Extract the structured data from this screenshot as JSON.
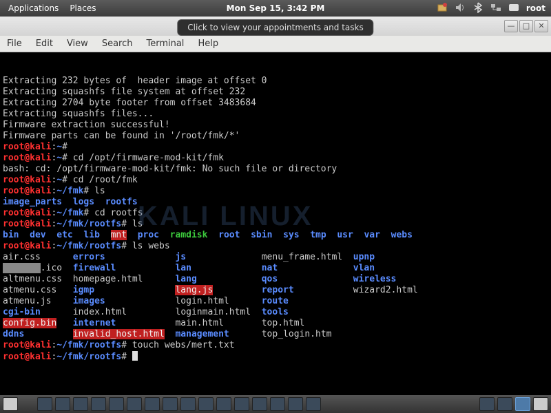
{
  "top_panel": {
    "applications": "Applications",
    "places": "Places",
    "clock": "Mon Sep 15,  3:42 PM",
    "user": "root"
  },
  "notification": "Click to view your appointments and tasks",
  "window_controls": {
    "min": "—",
    "max": "□",
    "close": "✕"
  },
  "menubar": {
    "file": "File",
    "edit": "Edit",
    "view": "View",
    "search": "Search",
    "terminal": "Terminal",
    "help": "Help"
  },
  "watermark": "KALI LINUX",
  "term": {
    "l1": "Extracting 232 bytes of  header image at offset 0",
    "l2": "Extracting squashfs file system at offset 232",
    "l3": "Extracting 2704 byte footer from offset 3483684",
    "l4": "Extracting squashfs files...",
    "l5": "Firmware extraction successful!",
    "l6": "Firmware parts can be found in '/root/fmk/*'",
    "p_userhost": "root@kali",
    "p_home": "~",
    "p_fmk": "~/fmk",
    "p_rootfs": "~/fmk/rootfs",
    "hash": "#",
    "cmd1": "cd /opt/firmware-mod-kit/fmk",
    "err1": "bash: cd: /opt/firmware-mod-kit/fmk: No such file or directory",
    "cmd2": "cd /root/fmk",
    "cmd3": "ls",
    "ls1": {
      "a": "image_parts",
      "b": "logs",
      "c": "rootfs"
    },
    "cmd4": "cd rootfs",
    "cmd5": "ls",
    "ls2": {
      "bin": "bin",
      "dev": "dev",
      "etc": "etc",
      "lib": "lib",
      "mnt": "mnt",
      "proc": "proc",
      "ramdisk": "ramdisk",
      "root": "root",
      "sbin": "sbin",
      "sys": "sys",
      "tmp": "tmp",
      "usr": "usr",
      "var": "var",
      "webs": "webs"
    },
    "cmd6": "ls webs",
    "webs": {
      "r1c1": "air.css",
      "r1c2": "errors",
      "r1c3": "js",
      "r1c4": "menu_frame.html",
      "r1c5": "upnp",
      "r2c1": ".ico",
      "r2c2": "firewall",
      "r2c3": "lan",
      "r2c4": "nat",
      "r2c5": "vlan",
      "r3c1": "altmenu.css",
      "r3c2": "homepage.html",
      "r3c3": "lang",
      "r3c4": "qos",
      "r3c5": "wireless",
      "r4c1": "atmenu.css",
      "r4c2": "igmp",
      "r4c3": "lang.js",
      "r4c4": "report",
      "r4c5": "wizard2.html",
      "r5c1": "atmenu.js",
      "r5c2": "images",
      "r5c3": "login.html",
      "r5c4": "route",
      "r5c5": "",
      "r6c1": "cgi-bin",
      "r6c2": "index.html",
      "r6c3": "loginmain.html",
      "r6c4": "tools",
      "r6c5": "",
      "r7c1": "config.bin",
      "r7c2": "internet",
      "r7c3": "main.html",
      "r7c4": "top.html",
      "r7c5": "",
      "r8c1": "ddns",
      "r8c2": "invalid_host.html",
      "r8c3": "management",
      "r8c4": "top_login.htm",
      "r8c5": ""
    },
    "cmd7": "touch webs/mert.txt"
  }
}
